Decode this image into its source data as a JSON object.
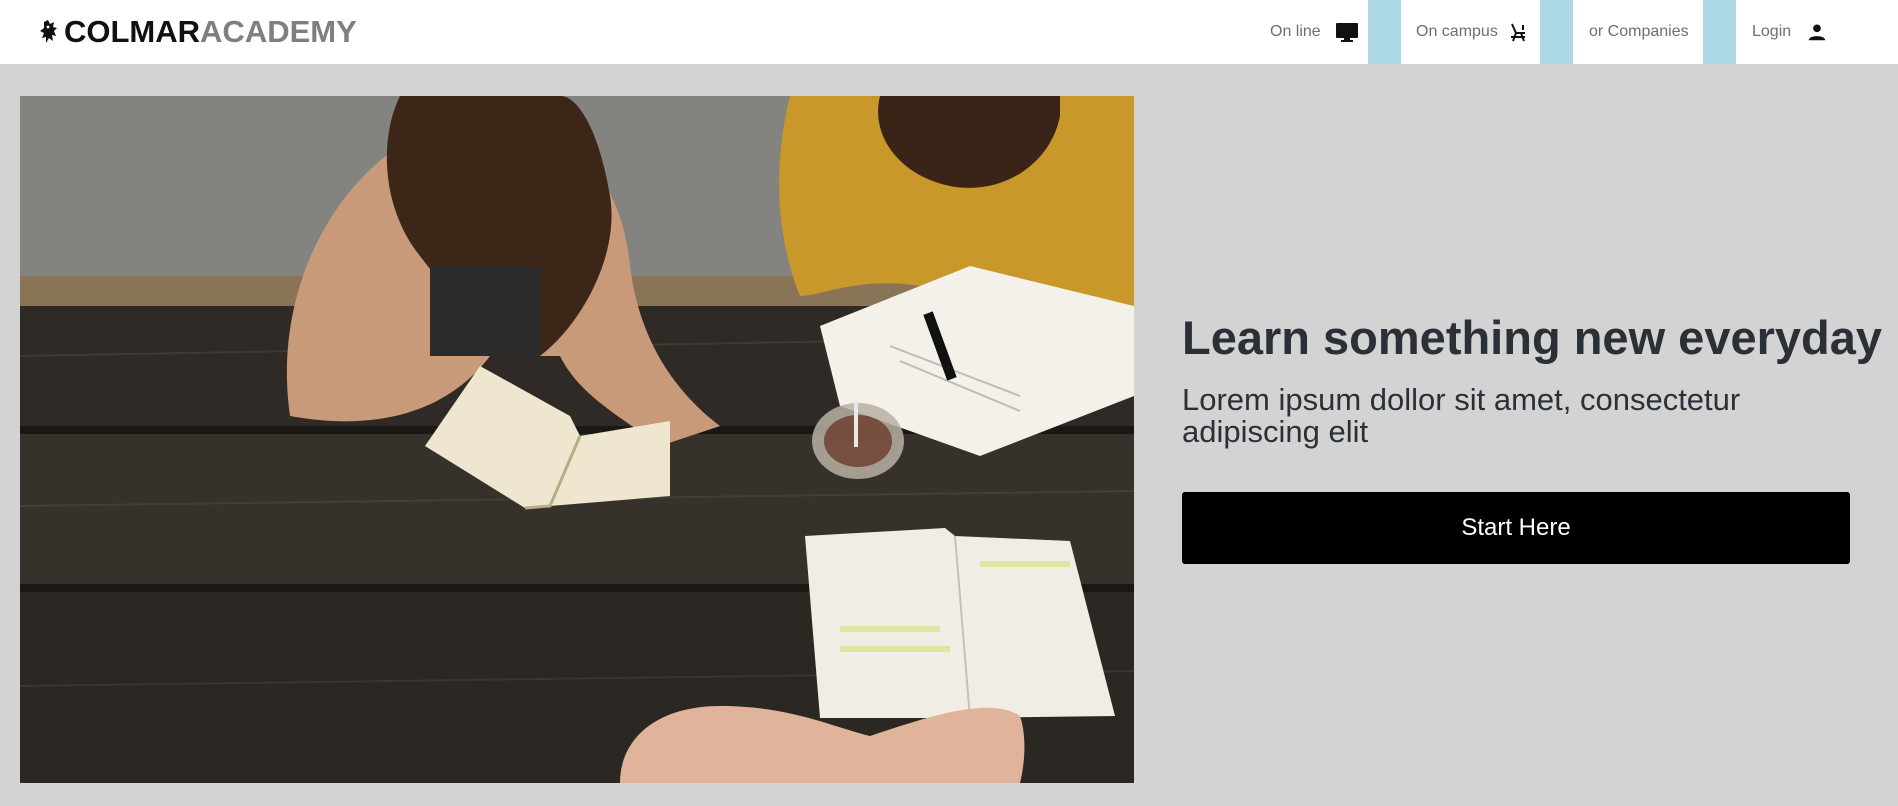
{
  "header": {
    "logo": {
      "primary": "COLMAR",
      "secondary": "ACADEMY",
      "icon": "lion-crest-icon"
    },
    "nav": [
      {
        "label": "On line",
        "icon": "monitor-icon"
      },
      {
        "label": "On campus",
        "icon": "desk-chair-icon"
      },
      {
        "label": "or Companies"
      },
      {
        "label": "Login",
        "icon": "user-icon"
      }
    ]
  },
  "hero": {
    "image": "students-studying-at-picnic-table-photo",
    "title": "Learn something new everyday",
    "subtitle": "Lorem ipsum dollor sit amet, consectetur adipiscing elit",
    "cta_label": "Start Here"
  },
  "colors": {
    "page_background": "#d3d3d3",
    "header_background": "#ffffff",
    "nav_divider": "#add8e6",
    "cta_background": "#000000",
    "heading_text": "#2b3037",
    "logo_secondary": "#7f7f7f"
  }
}
